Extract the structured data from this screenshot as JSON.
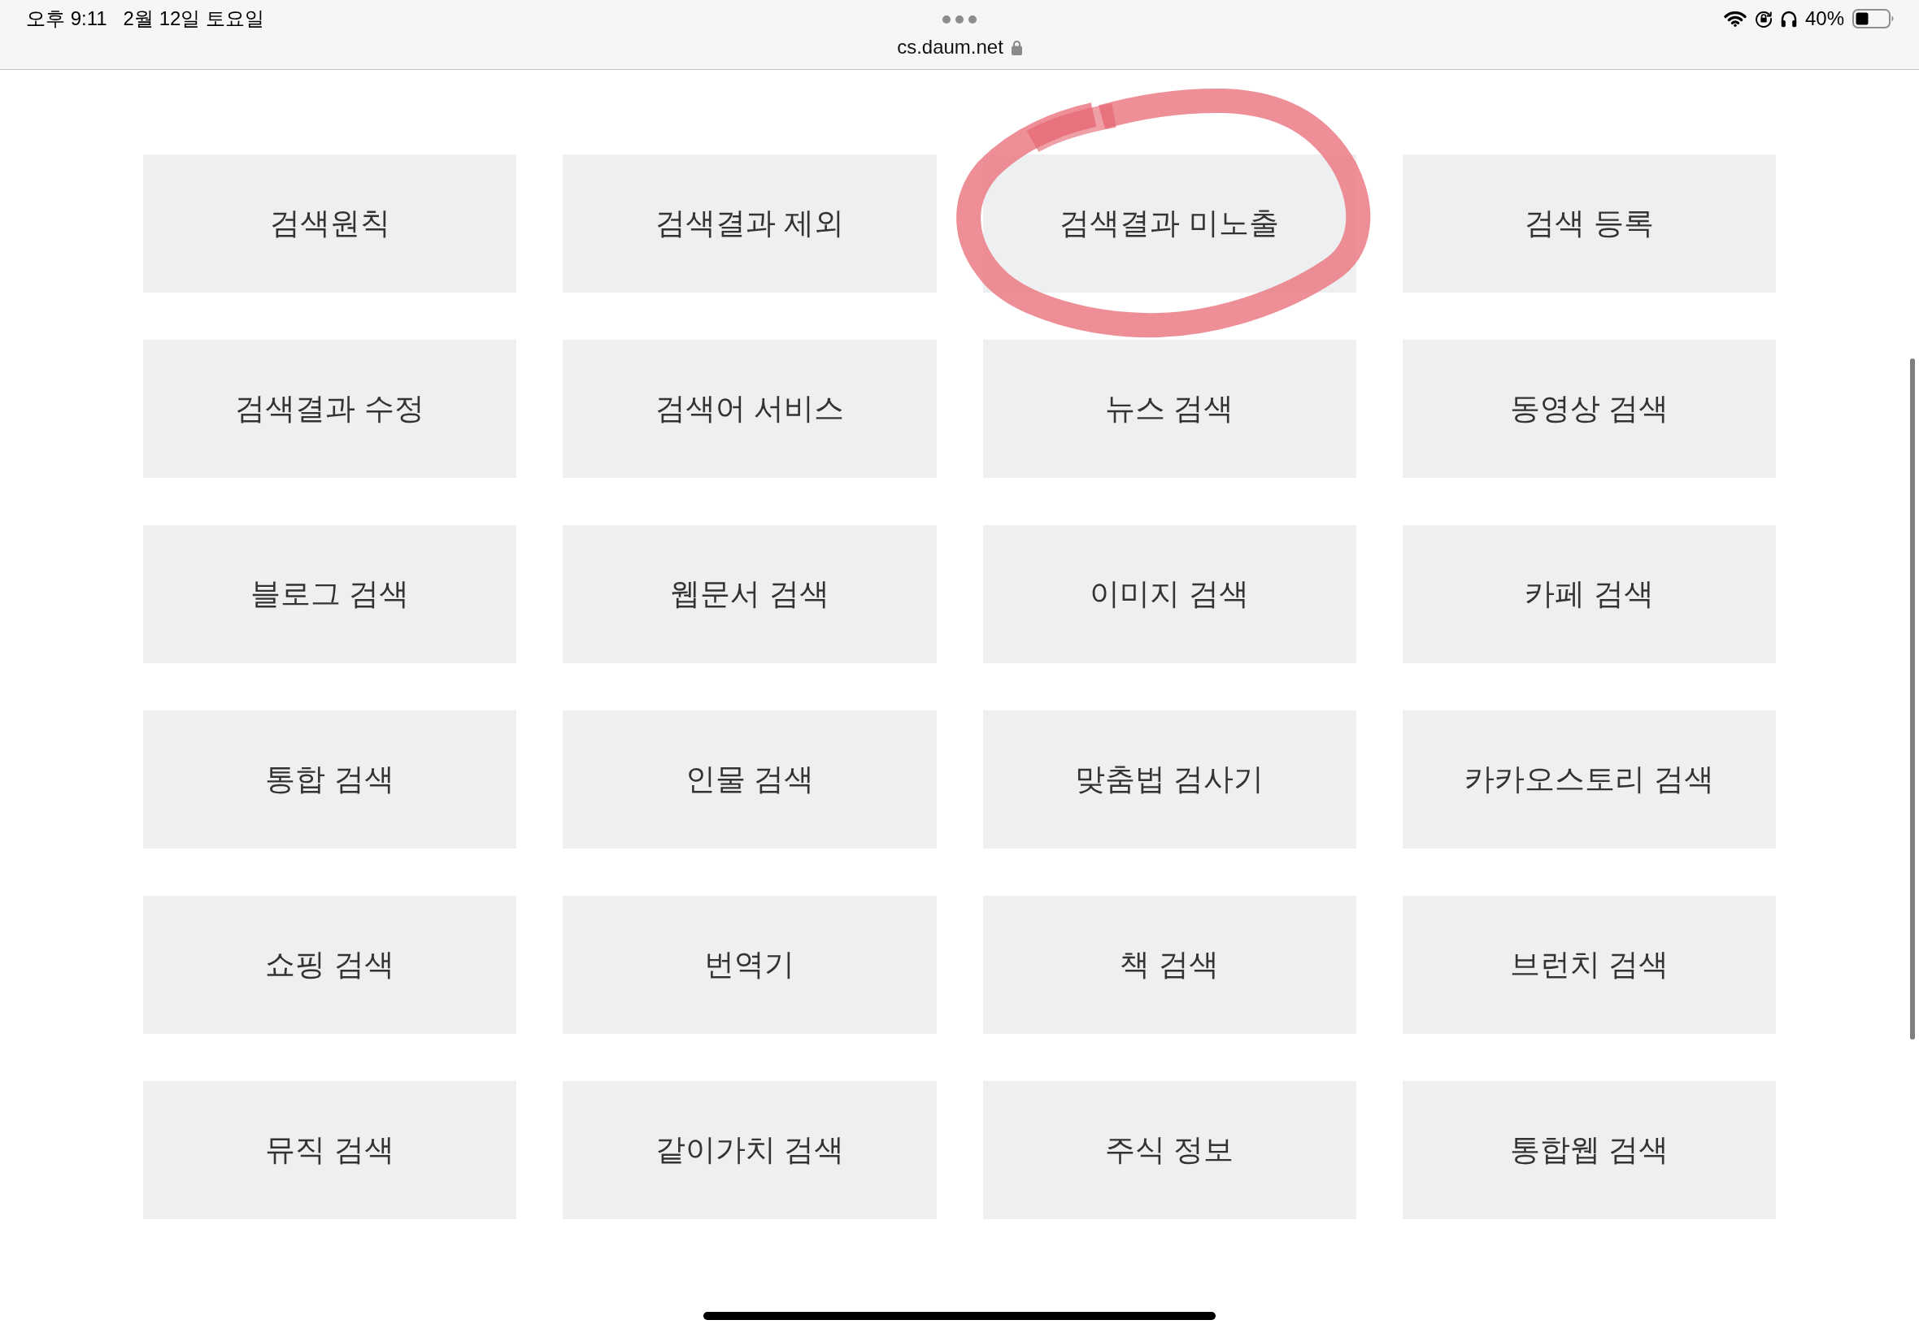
{
  "status_bar": {
    "time": "오후 9:11",
    "date": "2월 12일 토요일",
    "battery_percent": "40%"
  },
  "address_bar": {
    "url": "cs.daum.net"
  },
  "tiles": [
    {
      "label": "검색원칙",
      "circled": false
    },
    {
      "label": "검색결과 제외",
      "circled": false
    },
    {
      "label": "검색결과 미노출",
      "circled": true
    },
    {
      "label": "검색 등록",
      "circled": false
    },
    {
      "label": "검색결과 수정",
      "circled": false
    },
    {
      "label": "검색어 서비스",
      "circled": false
    },
    {
      "label": "뉴스 검색",
      "circled": false
    },
    {
      "label": "동영상 검색",
      "circled": false
    },
    {
      "label": "블로그 검색",
      "circled": false
    },
    {
      "label": "웹문서 검색",
      "circled": false
    },
    {
      "label": "이미지 검색",
      "circled": false
    },
    {
      "label": "카페 검색",
      "circled": false
    },
    {
      "label": "통합 검색",
      "circled": false
    },
    {
      "label": "인물 검색",
      "circled": false
    },
    {
      "label": "맞춤법 검사기",
      "circled": false
    },
    {
      "label": "카카오스토리 검색",
      "circled": false
    },
    {
      "label": "쇼핑 검색",
      "circled": false
    },
    {
      "label": "번역기",
      "circled": false
    },
    {
      "label": "책 검색",
      "circled": false
    },
    {
      "label": "브런치 검색",
      "circled": false
    },
    {
      "label": "뮤직 검색",
      "circled": false
    },
    {
      "label": "같이가치 검색",
      "circled": false
    },
    {
      "label": "주식 정보",
      "circled": false
    },
    {
      "label": "통합웹 검색",
      "circled": false
    }
  ]
}
